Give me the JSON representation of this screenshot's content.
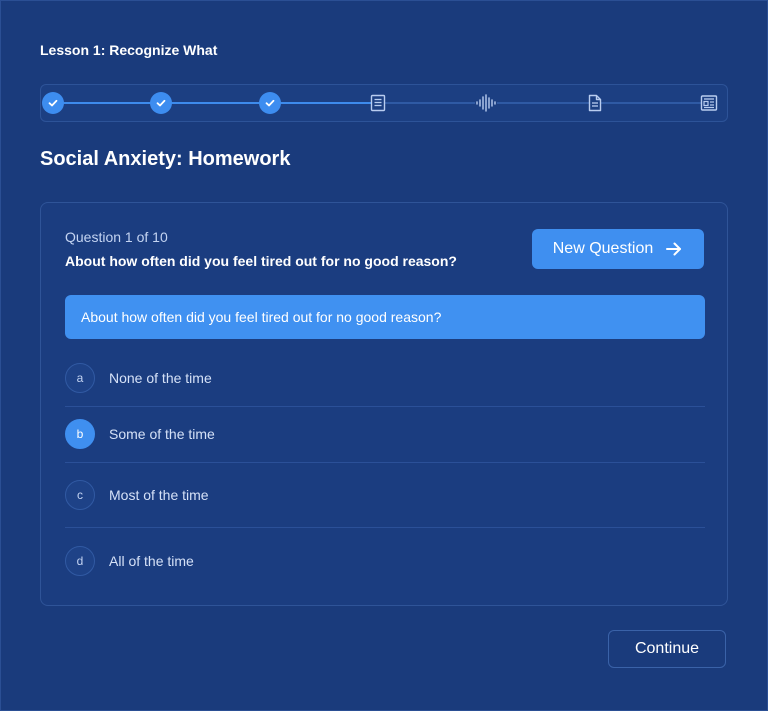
{
  "lesson": {
    "title": "Lesson 1: Recognize What"
  },
  "stepper": {
    "steps": [
      {
        "state": "done",
        "icon": "check-icon"
      },
      {
        "state": "done",
        "icon": "check-icon"
      },
      {
        "state": "done",
        "icon": "check-icon"
      },
      {
        "state": "todo",
        "icon": "article-icon"
      },
      {
        "state": "todo",
        "icon": "audio-wave-icon"
      },
      {
        "state": "todo",
        "icon": "document-icon"
      },
      {
        "state": "todo",
        "icon": "newspaper-icon"
      }
    ]
  },
  "section": {
    "title": "Social Anxiety: Homework"
  },
  "question": {
    "counter": "Question 1 of 10",
    "text": "About how often did you feel tired out for no good reason?",
    "prompt": "About how often did you feel tired out for no good reason?",
    "new_question_label": "New Question",
    "options": [
      {
        "key": "a",
        "label": "None of the time",
        "selected": false
      },
      {
        "key": "b",
        "label": "Some of the time",
        "selected": true
      },
      {
        "key": "c",
        "label": "Most of the time",
        "selected": false
      },
      {
        "key": "d",
        "label": "All of the time",
        "selected": false
      }
    ]
  },
  "footer": {
    "continue_label": "Continue"
  },
  "colors": {
    "background": "#1a3b7c",
    "accent": "#3f8ff0",
    "muted_text": "#c4d4f2"
  }
}
